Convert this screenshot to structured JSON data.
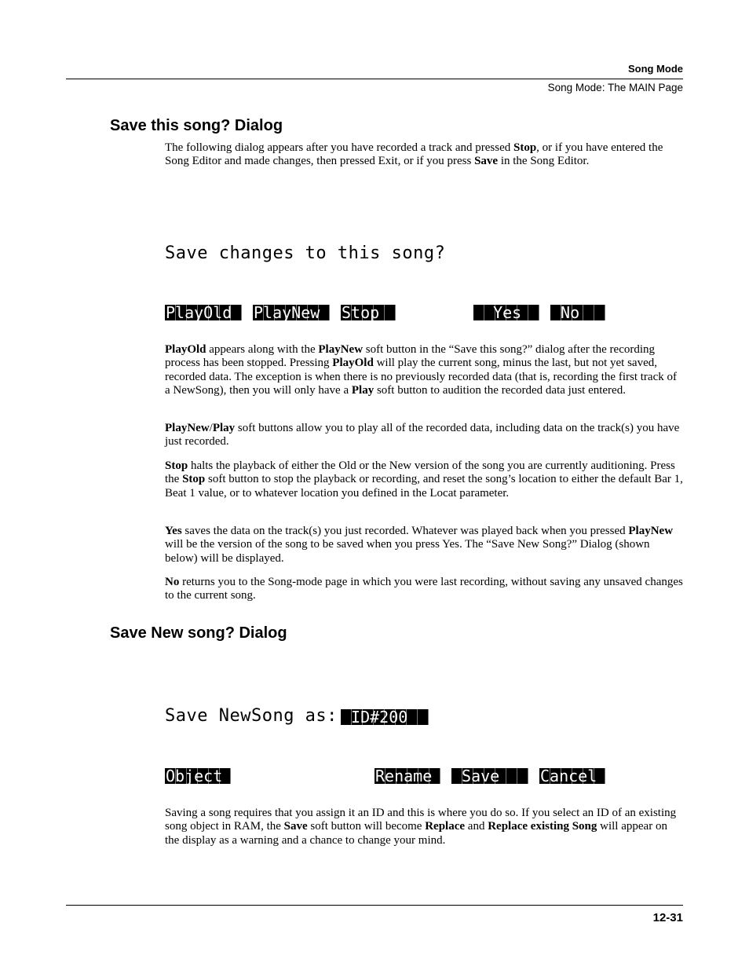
{
  "header": {
    "section": "Song Mode",
    "subsection": "Song Mode: The MAIN Page"
  },
  "section1": {
    "heading": "Save this song? Dialog",
    "intro": {
      "t1": "The following dialog appears after you have recorded a track and pressed ",
      "b1": "Stop",
      "t2": ", or if you have entered the Song Editor and made changes, then pressed Exit, or if you press ",
      "b2": "Save",
      "t3": " in the Song Editor."
    },
    "lcd": {
      "prompt": "Save changes to this song?",
      "buttons": [
        "PlayOld",
        "PlayNew",
        "Stop  ",
        "  Yes  ",
        " No  "
      ]
    },
    "para_playold": {
      "b1": "PlayOld",
      "t1": " appears along with the ",
      "b2": "PlayNew",
      "t2": " soft button in the “Save this song?” dialog after the recording process has been stopped. Pressing ",
      "b3": "PlayOld",
      "t3": " will play the current song, minus the last, but not yet saved, recorded data. The exception is when there is no previously recorded data (that is, recording the first track of a NewSong), then you will only have a ",
      "b4": "Play",
      "t4": " soft button to audition the recorded data just entered."
    },
    "para_playnew": {
      "b1": "PlayNew",
      "t1": "/",
      "b2": "Play",
      "t2": " soft buttons allow you to play all of the recorded data, including data on the track(s) you have just recorded."
    },
    "para_stop": {
      "b1": "Stop",
      "t1": " halts the playback of either the Old or the New version of the song you are currently auditioning. Press the ",
      "b2": "Stop",
      "t2": " soft button to stop the playback or recording, and reset the song’s location to either the default Bar 1, Beat 1 value, or to whatever location you defined in the Locat parameter."
    },
    "para_yes": {
      "b1": "Yes",
      "t1": " saves the data on the track(s) you just recorded. Whatever was played back when you pressed ",
      "b2": "PlayNew",
      "t2": " will be the version of the song to be saved when you press Yes. The “Save New Song?” Dialog (shown below) will be displayed."
    },
    "para_no": {
      "b1": "No",
      "t1": " returns you to the Song-mode page in which you were last recording, without saving any unsaved changes to the current song."
    }
  },
  "section2": {
    "heading": "Save New song? Dialog",
    "lcd": {
      "prompt": "Save NewSong as:",
      "id_value": " ID#200  ",
      "buttons": [
        "Object",
        "Rename",
        " Save  ",
        "Cancel"
      ]
    },
    "para": {
      "t1": "Saving a song requires that you assign it an ID and this is where you do so. If you select an ID of an existing song object in RAM, the ",
      "b1": "Save",
      "t2": " soft button will become ",
      "b2": "Replace",
      "t3": " and ",
      "b3": "Replace existing Song",
      "t4": " will appear on the display as a warning and a chance to change your mind."
    }
  },
  "footer": {
    "page_number": "12-31"
  }
}
